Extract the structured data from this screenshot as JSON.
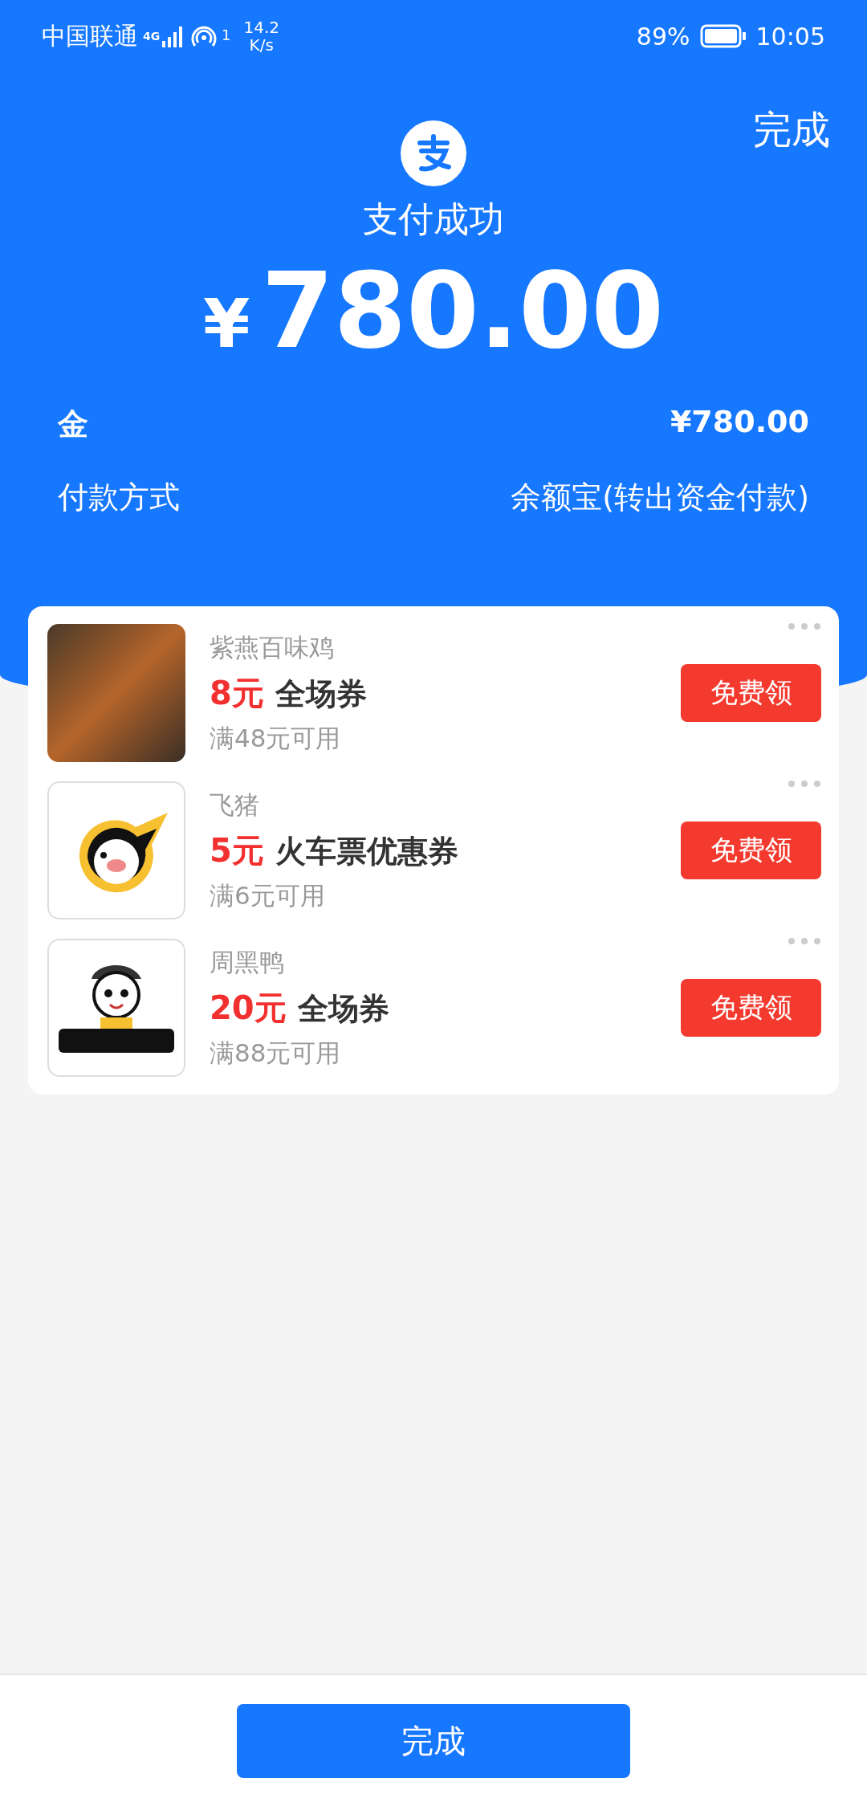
{
  "status_bar": {
    "carrier": "中国联通",
    "network": "4G",
    "hotspot_count": "1",
    "speed": "14.2",
    "speed_unit": "K/s",
    "battery": "89%",
    "time": "10:05"
  },
  "header": {
    "done": "完成",
    "title": "支付成功",
    "currency": "¥",
    "amount": "780.00"
  },
  "details": [
    {
      "label": "金",
      "value": "¥780.00",
      "emphasized": true
    },
    {
      "label": "付款方式",
      "value": "余额宝(转出资金付款)",
      "emphasized": false
    }
  ],
  "coupons": [
    {
      "kind": "photo",
      "merchant": "紫燕百味鸡",
      "value": "8元",
      "title": "全场券",
      "condition": "满48元可用",
      "button": "免费领"
    },
    {
      "kind": "pig-logo",
      "merchant": "飞猪",
      "value": "5元",
      "title": "火车票优惠券",
      "condition": "满6元可用",
      "button": "免费领"
    },
    {
      "kind": "character-logo",
      "merchant": "周黑鸭",
      "value": "20元",
      "title": "全场券",
      "condition": "满88元可用",
      "button": "免费领"
    }
  ],
  "bottom_button": "完成"
}
